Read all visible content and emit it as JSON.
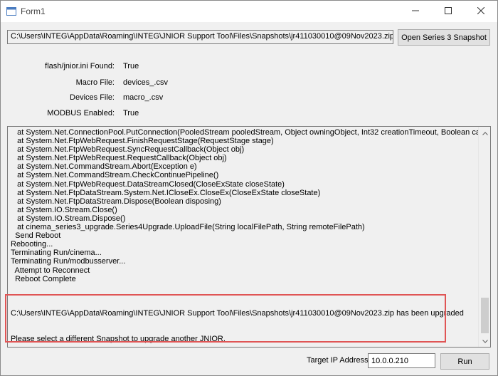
{
  "window": {
    "title": "Form1"
  },
  "snapshot": {
    "path": "C:\\Users\\INTEG\\AppData\\Roaming\\INTEG\\JNIOR Support Tool\\Files\\Snapshots\\jr411030010@09Nov2023.zip",
    "open_button_label": "Open Series 3 Snapshot"
  },
  "info": {
    "jnior_ini_label": "flash/jnior.ini Found:",
    "jnior_ini_value": "True",
    "macro_label": "Macro File:",
    "macro_value": "devices_.csv",
    "devices_label": "Devices File:",
    "devices_value": "macro_.csv",
    "modbus_label": "MODBUS Enabled:",
    "modbus_value": "True"
  },
  "log": {
    "lines": [
      "   at System.Net.ConnectionPool.PutConnection(PooledStream pooledStream, Object owningObject, Int32 creationTimeout, Boolean canReuse)",
      "   at System.Net.FtpWebRequest.FinishRequestStage(RequestStage stage)",
      "   at System.Net.FtpWebRequest.SyncRequestCallback(Object obj)",
      "   at System.Net.FtpWebRequest.RequestCallback(Object obj)",
      "   at System.Net.CommandStream.Abort(Exception e)",
      "   at System.Net.CommandStream.CheckContinuePipeline()",
      "   at System.Net.FtpWebRequest.DataStreamClosed(CloseExState closeState)",
      "   at System.Net.FtpDataStream.System.Net.ICloseEx.CloseEx(CloseExState closeState)",
      "   at System.Net.FtpDataStream.Dispose(Boolean disposing)",
      "   at System.IO.Stream.Close()",
      "   at System.IO.Stream.Dispose()",
      "   at cinema_series3_upgrade.Series4Upgrade.UploadFile(String localFilePath, String remoteFilePath)",
      "  Send Reboot",
      "Rebooting...",
      "Terminating Run/cinema...",
      "Terminating Run/modbusserver...",
      "  Attempt to Reconnect",
      "  Reboot Complete",
      "",
      "",
      "",
      "C:\\Users\\INTEG\\AppData\\Roaming\\INTEG\\JNIOR Support Tool\\Files\\Snapshots\\jr411030010@09Nov2023.zip has been upgraded",
      "",
      "",
      "Please select a different Snapshot to upgrade another JNIOR."
    ]
  },
  "footer": {
    "ip_label": "Target IP Address",
    "ip_value": "10.0.0.210",
    "run_label": "Run"
  },
  "colors": {
    "highlight": "#e05555",
    "window_bg": "#f0f0f0"
  }
}
